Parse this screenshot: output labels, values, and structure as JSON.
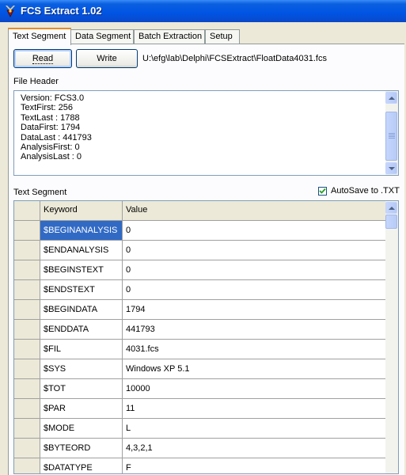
{
  "window": {
    "title": "FCS Extract 1.02"
  },
  "tabs": [
    "Text Segment",
    "Data Segment",
    "Batch Extraction",
    "Setup"
  ],
  "toolbar": {
    "read_label": "Read",
    "write_label": "Write",
    "file_path": "U:\\efg\\lab\\Delphi\\FCSExtract\\FloatData4031.fcs"
  },
  "file_header": {
    "label": "File Header",
    "lines": [
      "Version:  FCS3.0",
      "TextFirst:  256",
      "TextLast :  1788",
      "DataFirst:  1794",
      "DataLast :  441793",
      "AnalysisFirst:  0",
      "AnalysisLast :  0"
    ]
  },
  "text_segment": {
    "label": "Text Segment",
    "autosave_label": "AutoSave to .TXT",
    "autosave_checked": true,
    "columns": [
      "Keyword",
      "Value"
    ],
    "rows": [
      [
        "$BEGINANALYSIS",
        "0"
      ],
      [
        "$ENDANALYSIS",
        "0"
      ],
      [
        "$BEGINSTEXT",
        "0"
      ],
      [
        "$ENDSTEXT",
        "0"
      ],
      [
        "$BEGINDATA",
        "1794"
      ],
      [
        "$ENDDATA",
        "441793"
      ],
      [
        "$FIL",
        "4031.fcs"
      ],
      [
        "$SYS",
        "Windows XP 5.1"
      ],
      [
        "$TOT",
        "10000"
      ],
      [
        "$PAR",
        "11"
      ],
      [
        "$MODE",
        "L"
      ],
      [
        "$BYTEORD",
        "4,3,2,1"
      ],
      [
        "$DATATYPE",
        "F"
      ]
    ]
  },
  "colors": {
    "titlebar": "#0054e3",
    "selection": "#316ac5",
    "active_tab_accent": "#e68b2c"
  }
}
